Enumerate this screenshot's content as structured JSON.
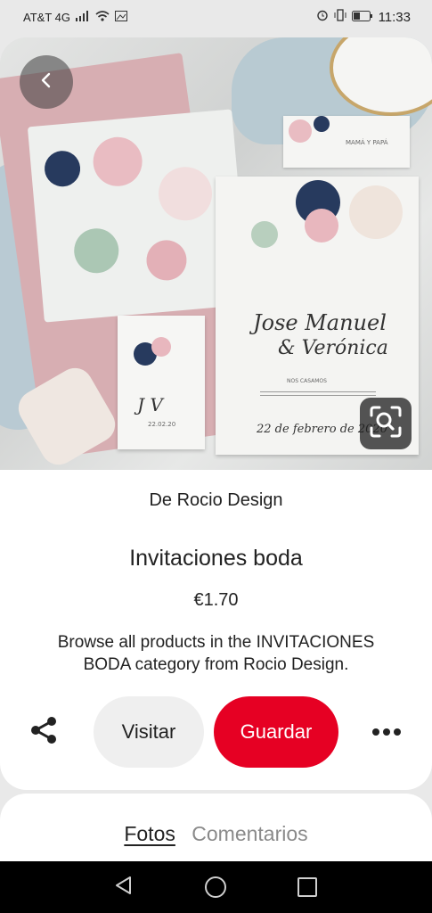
{
  "status_bar": {
    "carrier": "AT&T 4G",
    "time": "11:33"
  },
  "hero": {
    "invite_names_line1": "Jose Manuel",
    "invite_names_line2": "& Verónica",
    "invite_date": "22 de febrero de 2020",
    "invite_heading": "NOS CASAMOS",
    "strip_text": "MAMÁ Y PAPÁ",
    "tag_initials": "J  V",
    "tag_date": "22.02.20"
  },
  "pin": {
    "by_prefix": "De",
    "author": "Rocio Design",
    "title": "Invitaciones boda",
    "price": "€1.70",
    "description": "Browse all products in the INVITACIONES BODA category from Rocio Design."
  },
  "actions": {
    "visit_label": "Visitar",
    "save_label": "Guardar"
  },
  "tabs": [
    {
      "label": "Fotos",
      "active": true
    },
    {
      "label": "Comentarios",
      "active": false
    }
  ],
  "colors": {
    "save_red": "#e60023",
    "visit_gray": "#efefef"
  }
}
